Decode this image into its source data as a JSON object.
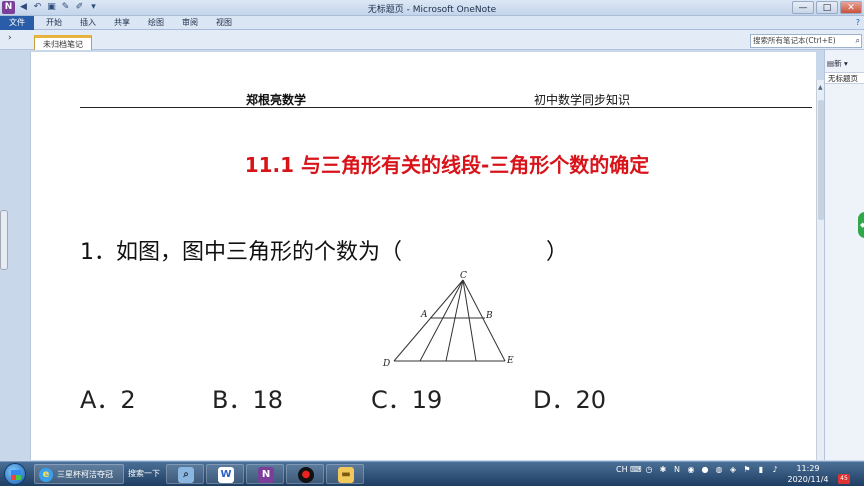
{
  "window": {
    "title": "无标题页 - Microsoft OneNote",
    "app_icon": "N",
    "controls": {
      "minimize": "—",
      "maximize": "□",
      "close": "✕"
    }
  },
  "ribbon": {
    "file_tab": "文件",
    "tabs": [
      "开始",
      "插入",
      "共享",
      "绘图",
      "审阅",
      "视图"
    ],
    "help": "?"
  },
  "notebook": {
    "expand_icon": "›",
    "section_tab": "未归档笔记",
    "search_placeholder": "搜索所有笔记本(Ctrl+E)"
  },
  "pages_panel": {
    "new_page_label": "新",
    "page_title": "无标题页"
  },
  "document": {
    "header_left": "郑根亮数学",
    "header_right": "初中数学同步知识",
    "lesson_title": "11.1 与三角形有关的线段-三角形个数的确定",
    "question": "1．如图，图中三角形的个数为（",
    "question_close": "）",
    "figure_labels": {
      "C": "C",
      "A": "A",
      "B": "B",
      "D": "D",
      "E": "E"
    },
    "options": [
      "A．2",
      "B．18",
      "C．19",
      "D．20"
    ]
  },
  "taskbar": {
    "ie_label": "三星杯柯洁夺冠",
    "search_label": "搜索一下",
    "tray_lang": "CH",
    "time": "11:29",
    "date": "2020/11/4",
    "notification_count": "45"
  }
}
